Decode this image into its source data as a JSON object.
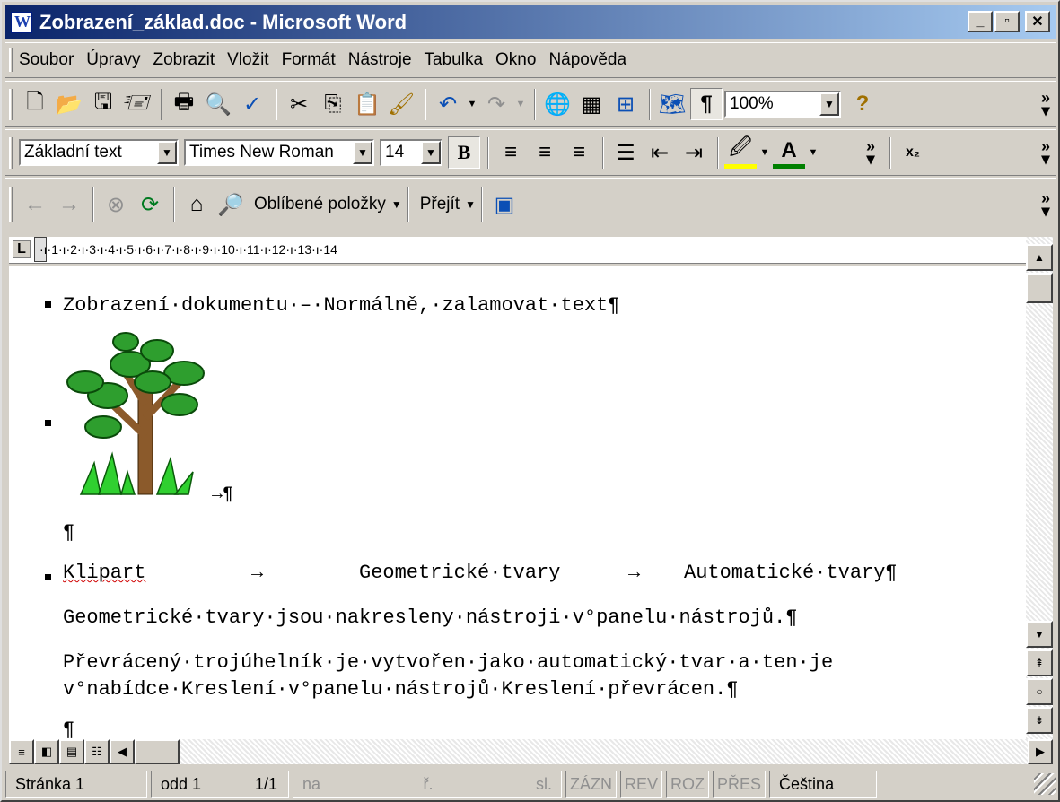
{
  "title": "Zobrazení_základ.doc - Microsoft Word",
  "menu": [
    "Soubor",
    "Úpravy",
    "Zobrazit",
    "Vložit",
    "Formát",
    "Nástroje",
    "Tabulka",
    "Okno",
    "Nápověda"
  ],
  "toolbar": {
    "zoom": "100%",
    "style": "Základní text",
    "font": "Times New Roman",
    "size": "14",
    "bold": "B",
    "favorites": "Oblíbené položky",
    "go": "Přejít"
  },
  "ruler": "·ı·1·ı·2·ı·3·ı·4·ı·5·ı·6·ı·7·ı·8·ı·9·ı·10·ı·11·ı·12·ı·13·ı·14",
  "document": {
    "line1": "Zobrazení·dokumentu·–·Normálně,·zalamovat·text¶",
    "tree_mark": "→¶",
    "empty_para": "¶",
    "klipart": "Klipart",
    "arrow": "→",
    "geo": "Geometrické·tvary",
    "auto": "Automatické·tvary¶",
    "line4": "Geometrické·tvary·jsou·nakresleny·nástroji·v°panelu·nástrojů.¶",
    "line5": "Převrácený·trojúhelník·je·vytvořen·jako·automatický·tvar·a·ten·je",
    "line6": "v°nabídce·Kreslení·v°panelu·nástrojů·Kreslení·převrácen.¶",
    "line7": "¶"
  },
  "status": {
    "page": "Stránka 1",
    "section": "odd 1",
    "pages": "1/1",
    "at": "na",
    "line": "ř.",
    "col": "sl.",
    "rec": "ZÁZN",
    "rev": "REV",
    "ext": "ROZ",
    "ovr": "PŘES",
    "lang": "Čeština"
  },
  "colors": {
    "titlebar": "#0a246a",
    "face": "#d4d0c8",
    "spell": "#d00000"
  }
}
